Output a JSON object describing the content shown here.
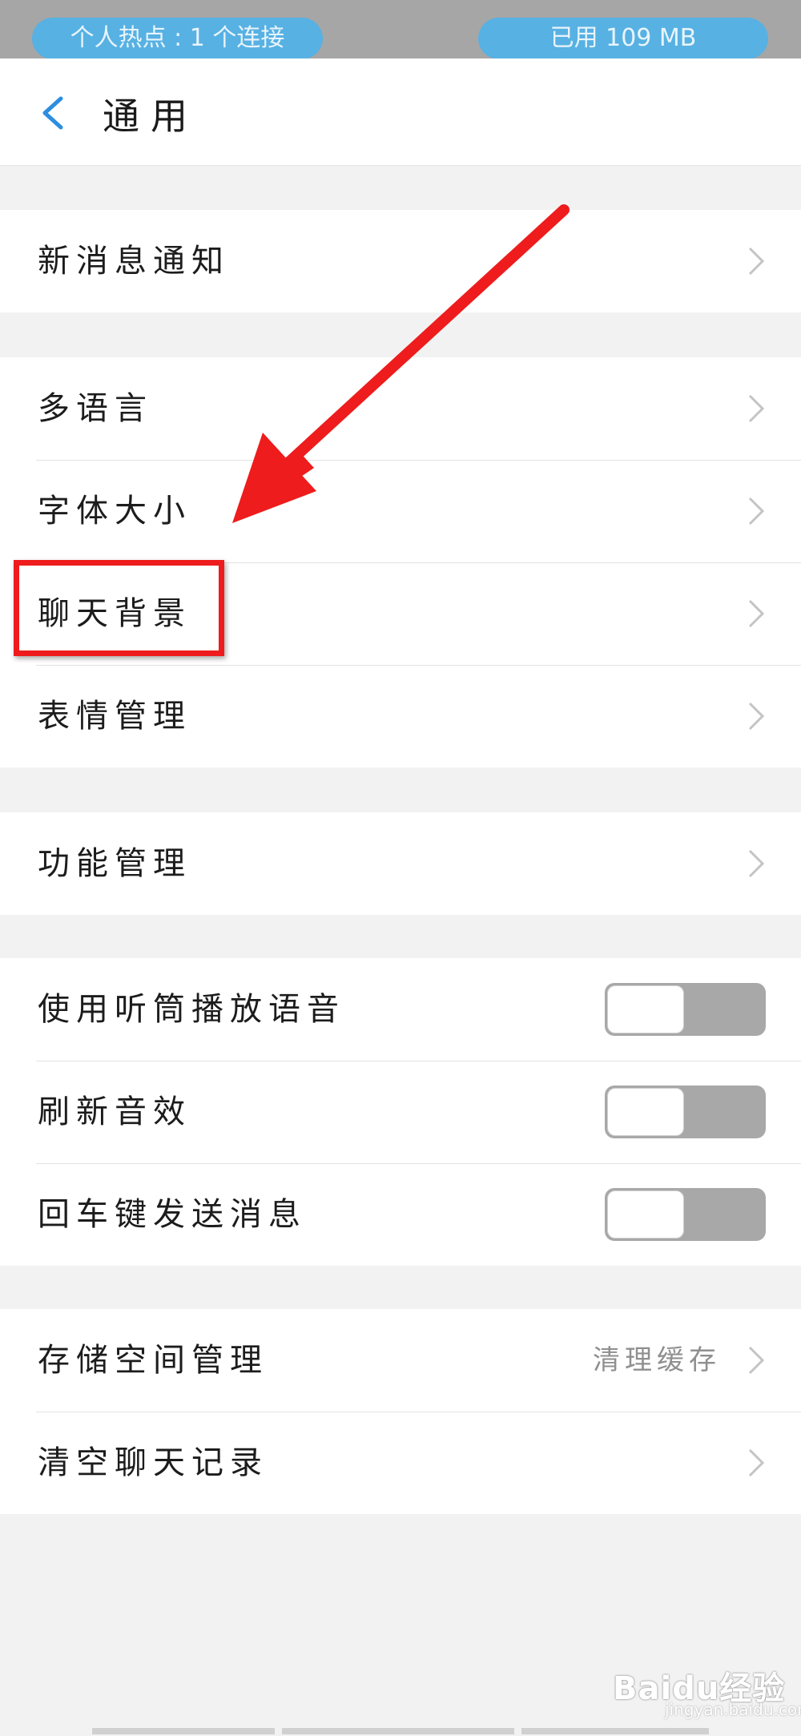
{
  "status_bar": {
    "hotspot": "个人热点 : 1 个连接",
    "data_used": "已用 109 MB"
  },
  "header": {
    "back_icon": "chevron-left-icon",
    "title": "通用"
  },
  "sections": [
    {
      "rows": [
        {
          "label": "新消息通知"
        }
      ]
    },
    {
      "rows": [
        {
          "label": "多语言"
        },
        {
          "label": "字体大小"
        },
        {
          "label": "聊天背景"
        },
        {
          "label": "表情管理"
        }
      ]
    },
    {
      "rows": [
        {
          "label": "功能管理"
        }
      ]
    },
    {
      "rows": [
        {
          "label": "使用听筒播放语音",
          "toggle": false
        },
        {
          "label": "刷新音效",
          "toggle": false
        },
        {
          "label": "回车键发送消息",
          "toggle": false
        }
      ]
    },
    {
      "rows": [
        {
          "label": "存储空间管理",
          "value": "清理缓存"
        },
        {
          "label": "清空聊天记录"
        }
      ]
    }
  ],
  "annotation": {
    "highlight_color": "#ee1c1c",
    "arrow_color": "#ee1c1c"
  },
  "watermark": {
    "brand": "Baidu经验",
    "url": "jingyan.baidu.com"
  },
  "colors": {
    "accent": "#2b8ee0",
    "pill": "#57b1e3",
    "toggle_off": "#a8a8a8"
  }
}
